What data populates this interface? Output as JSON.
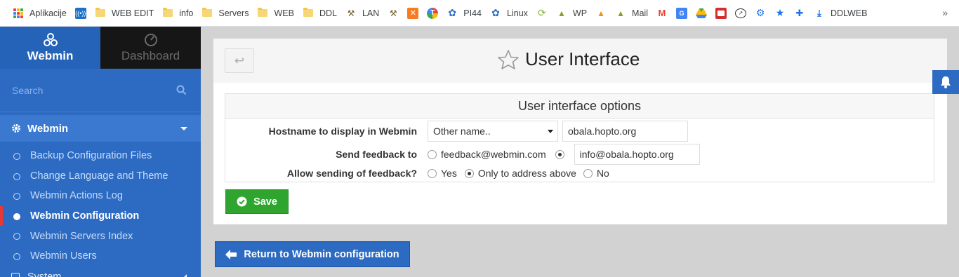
{
  "bookmarks": [
    {
      "label": "Aplikacije",
      "icon": "apps-grid-icon"
    },
    {
      "label": "",
      "icon": "wifi-icon"
    },
    {
      "label": "WEB EDIT",
      "icon": "folder-icon"
    },
    {
      "label": "info",
      "icon": "folder-icon"
    },
    {
      "label": "Servers",
      "icon": "folder-icon"
    },
    {
      "label": "WEB",
      "icon": "folder-icon"
    },
    {
      "label": "DDL",
      "icon": "folder-icon"
    },
    {
      "label": "LAN",
      "icon": "lan-icon"
    },
    {
      "label": "",
      "icon": "lan2-icon"
    },
    {
      "label": "",
      "icon": "xampp-icon"
    },
    {
      "label": "",
      "icon": "t-circle-icon"
    },
    {
      "label": "PI44",
      "icon": "webmin-icon"
    },
    {
      "label": "Linux",
      "icon": "webmin-icon"
    },
    {
      "label": "",
      "icon": "sync-icon"
    },
    {
      "label": "WP",
      "icon": "triangle-icon"
    },
    {
      "label": "",
      "icon": "pma-icon"
    },
    {
      "label": "Mail",
      "icon": "triangle-icon"
    },
    {
      "label": "",
      "icon": "gmail-icon"
    },
    {
      "label": "",
      "icon": "translate-icon"
    },
    {
      "label": "",
      "icon": "drive-icon"
    },
    {
      "label": "",
      "icon": "card-icon"
    },
    {
      "label": "",
      "icon": "speed-icon"
    },
    {
      "label": "",
      "icon": "gear-icon"
    },
    {
      "label": "",
      "icon": "star-icon"
    },
    {
      "label": "",
      "icon": "puzzle-icon"
    },
    {
      "label": "DDLWEB",
      "icon": "download-icon"
    }
  ],
  "bookmarks_more": "»",
  "sidebar": {
    "tab_webmin": "Webmin",
    "tab_dashboard": "Dashboard",
    "search_placeholder": "Search",
    "section": "Webmin",
    "items": [
      {
        "label": "Backup Configuration Files"
      },
      {
        "label": "Change Language and Theme"
      },
      {
        "label": "Webmin Actions Log"
      },
      {
        "label": "Webmin Configuration"
      },
      {
        "label": "Webmin Servers Index"
      },
      {
        "label": "Webmin Users"
      }
    ],
    "next_section": "System"
  },
  "page": {
    "title": "User Interface",
    "back_glyph": "↩"
  },
  "form": {
    "header": "User interface options",
    "hostname_label": "Hostname to display in Webmin",
    "hostname_select": "Other name..",
    "hostname_value": "obala.hopto.org",
    "feedback_label": "Send feedback to",
    "feedback_option1": "feedback@webmin.com",
    "feedback_value": "info@obala.hopto.org",
    "allow_label": "Allow sending of feedback?",
    "allow_yes": "Yes",
    "allow_only": "Only to address above",
    "allow_no": "No",
    "save_label": "Save"
  },
  "return_label": "Return to Webmin configuration",
  "colors": {
    "sidebar": "#2d6bc3",
    "save": "#2fa530",
    "active_marker": "#e53935"
  }
}
